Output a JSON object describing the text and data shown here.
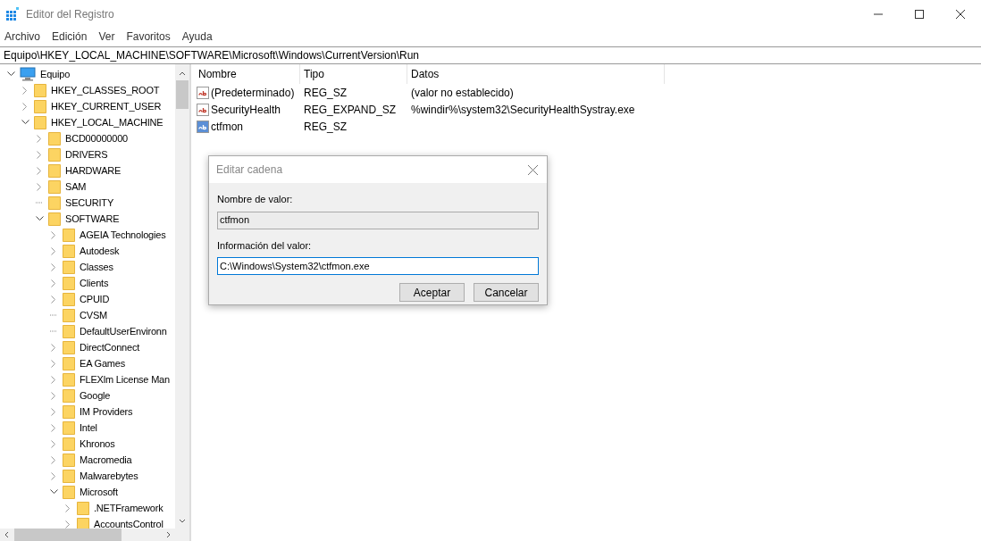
{
  "window": {
    "title": "Editor del Registro"
  },
  "menu": [
    "Archivo",
    "Edición",
    "Ver",
    "Favoritos",
    "Ayuda"
  ],
  "address": "Equipo\\HKEY_LOCAL_MACHINE\\SOFTWARE\\Microsoft\\Windows\\CurrentVersion\\Run",
  "tree": [
    {
      "label": "Equipo",
      "kind": "computer",
      "expanded": true,
      "children": [
        {
          "label": "HKEY_CLASSES_ROOT",
          "kind": "key",
          "expanded": false
        },
        {
          "label": "HKEY_CURRENT_USER",
          "kind": "key",
          "expanded": false
        },
        {
          "label": "HKEY_LOCAL_MACHINE",
          "kind": "key",
          "expanded": true,
          "children": [
            {
              "label": "BCD00000000",
              "kind": "key",
              "expanded": false
            },
            {
              "label": "DRIVERS",
              "kind": "key",
              "expanded": false
            },
            {
              "label": "HARDWARE",
              "kind": "key",
              "expanded": false
            },
            {
              "label": "SAM",
              "kind": "key",
              "expanded": false
            },
            {
              "label": "SECURITY",
              "kind": "leaf"
            },
            {
              "label": "SOFTWARE",
              "kind": "key",
              "expanded": true,
              "children": [
                {
                  "label": "AGEIA Technologies",
                  "kind": "key",
                  "expanded": false
                },
                {
                  "label": "Autodesk",
                  "kind": "key",
                  "expanded": false
                },
                {
                  "label": "Classes",
                  "kind": "key",
                  "expanded": false
                },
                {
                  "label": "Clients",
                  "kind": "key",
                  "expanded": false
                },
                {
                  "label": "CPUID",
                  "kind": "key",
                  "expanded": false
                },
                {
                  "label": "CVSM",
                  "kind": "leaf"
                },
                {
                  "label": "DefaultUserEnvironn",
                  "kind": "leaf"
                },
                {
                  "label": "DirectConnect",
                  "kind": "key",
                  "expanded": false
                },
                {
                  "label": "EA Games",
                  "kind": "key",
                  "expanded": false
                },
                {
                  "label": "FLEXlm License Man",
                  "kind": "key",
                  "expanded": false
                },
                {
                  "label": "Google",
                  "kind": "key",
                  "expanded": false
                },
                {
                  "label": "IM Providers",
                  "kind": "key",
                  "expanded": false
                },
                {
                  "label": "Intel",
                  "kind": "key",
                  "expanded": false
                },
                {
                  "label": "Khronos",
                  "kind": "key",
                  "expanded": false
                },
                {
                  "label": "Macromedia",
                  "kind": "key",
                  "expanded": false
                },
                {
                  "label": "Malwarebytes",
                  "kind": "key",
                  "expanded": false
                },
                {
                  "label": "Microsoft",
                  "kind": "key",
                  "expanded": true,
                  "children": [
                    {
                      "label": ".NETFramework",
                      "kind": "key",
                      "expanded": false
                    },
                    {
                      "label": "AccountsControl",
                      "kind": "key",
                      "expanded": false
                    }
                  ]
                }
              ]
            }
          ]
        }
      ]
    }
  ],
  "table": {
    "columns": [
      "Nombre",
      "Tipo",
      "Datos"
    ],
    "rows": [
      {
        "name": "(Predeterminado)",
        "type": "REG_SZ",
        "data": "(valor no establecido)",
        "kind": "string"
      },
      {
        "name": "SecurityHealth",
        "type": "REG_EXPAND_SZ",
        "data": "%windir%\\system32\\SecurityHealthSystray.exe",
        "kind": "string"
      },
      {
        "name": "ctfmon",
        "type": "REG_SZ",
        "data": "",
        "kind": "selected-string"
      }
    ]
  },
  "dialog": {
    "title": "Editar cadena",
    "name_label": "Nombre de valor:",
    "name_value": "ctfmon",
    "data_label": "Información del valor:",
    "data_value": "C:\\Windows\\System32\\ctfmon.exe",
    "buttons": [
      "Aceptar",
      "Cancelar"
    ]
  }
}
